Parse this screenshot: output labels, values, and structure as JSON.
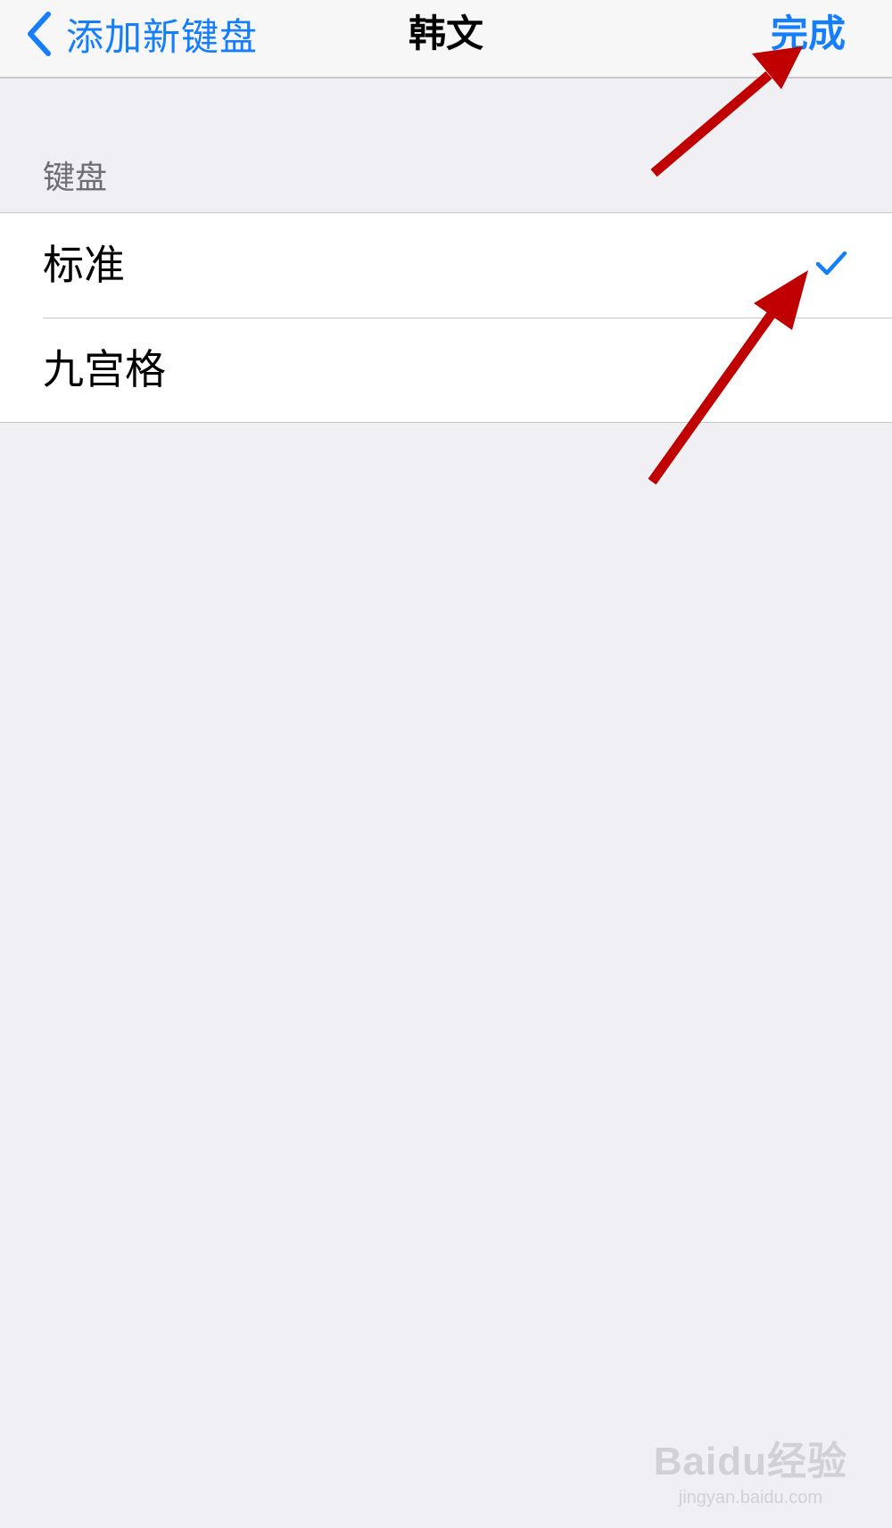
{
  "nav": {
    "back_label": "添加新键盘",
    "title": "韩文",
    "done_label": "完成"
  },
  "section": {
    "header": "键盘"
  },
  "options": [
    {
      "label": "标准",
      "selected": true
    },
    {
      "label": "九宫格",
      "selected": false
    }
  ],
  "watermark": {
    "logo": "Baidu经验",
    "site": "jingyan.baidu.com"
  },
  "colors": {
    "accent": "#147efb",
    "arrow": "#c00000",
    "background": "#efeff4"
  },
  "icons": {
    "back": "chevron-left-icon",
    "selected": "checkmark-icon"
  }
}
